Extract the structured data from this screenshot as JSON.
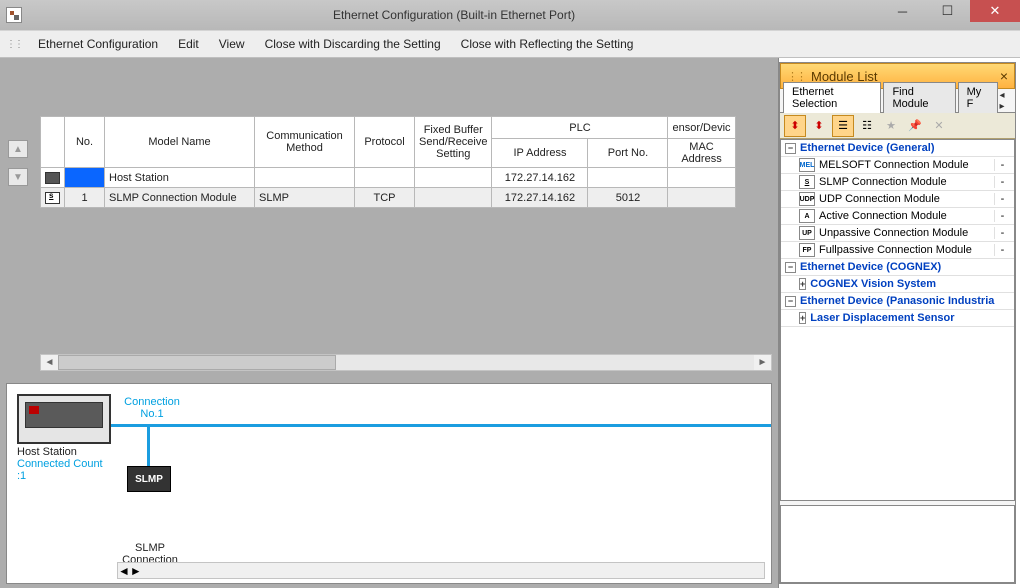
{
  "window": {
    "title": "Ethernet Configuration (Built-in Ethernet Port)"
  },
  "menu": {
    "ethernet_config": "Ethernet Configuration",
    "edit": "Edit",
    "view": "View",
    "close_discard": "Close with Discarding the Setting",
    "close_reflect": "Close with Reflecting the Setting"
  },
  "table": {
    "headers": {
      "no": "No.",
      "model": "Model Name",
      "comm": "Communication Method",
      "protocol": "Protocol",
      "fixedbuf": "Fixed Buffer Send/Receive Setting",
      "plc": "PLC",
      "ip": "IP Address",
      "port": "Port No.",
      "sensor": "ensor/Devic",
      "mac": "MAC Address"
    },
    "rows": [
      {
        "no": "",
        "model": "Host Station",
        "comm": "",
        "protocol": "",
        "fixed": "",
        "ip": "172.27.14.162",
        "port": "",
        "mac": ""
      },
      {
        "no": "1",
        "model": "SLMP Connection Module",
        "comm": "SLMP",
        "protocol": "TCP",
        "fixed": "",
        "ip": "172.27.14.162",
        "port": "5012",
        "mac": ""
      }
    ]
  },
  "diagram": {
    "host_label": "Host Station",
    "connected": "Connected Count :1",
    "conn_label": "Connection No.1",
    "slmp_box": "SLMP",
    "slmp_label": "SLMP Connection Module"
  },
  "modulelist": {
    "title": "Module List",
    "tabs": {
      "ethernet_sel": "Ethernet Selection",
      "find": "Find Module",
      "myf": "My F"
    },
    "groups": {
      "general": "Ethernet Device (General)",
      "cognex": "Ethernet Device (COGNEX)",
      "cognex_sub": "COGNEX Vision System",
      "panasonic": "Ethernet Device (Panasonic Industria",
      "panasonic_sub": "Laser Displacement Sensor"
    },
    "items": [
      {
        "icon": "MEL",
        "label": "MELSOFT Connection Module",
        "dash": "-"
      },
      {
        "icon": "S",
        "label": "SLMP Connection Module",
        "dash": "-"
      },
      {
        "icon": "UDP",
        "label": "UDP Connection Module",
        "dash": "-"
      },
      {
        "icon": "A",
        "label": "Active Connection Module",
        "dash": "-"
      },
      {
        "icon": "UP",
        "label": "Unpassive Connection Module",
        "dash": "-"
      },
      {
        "icon": "FP",
        "label": "Fullpassive Connection Module",
        "dash": "-"
      }
    ]
  }
}
